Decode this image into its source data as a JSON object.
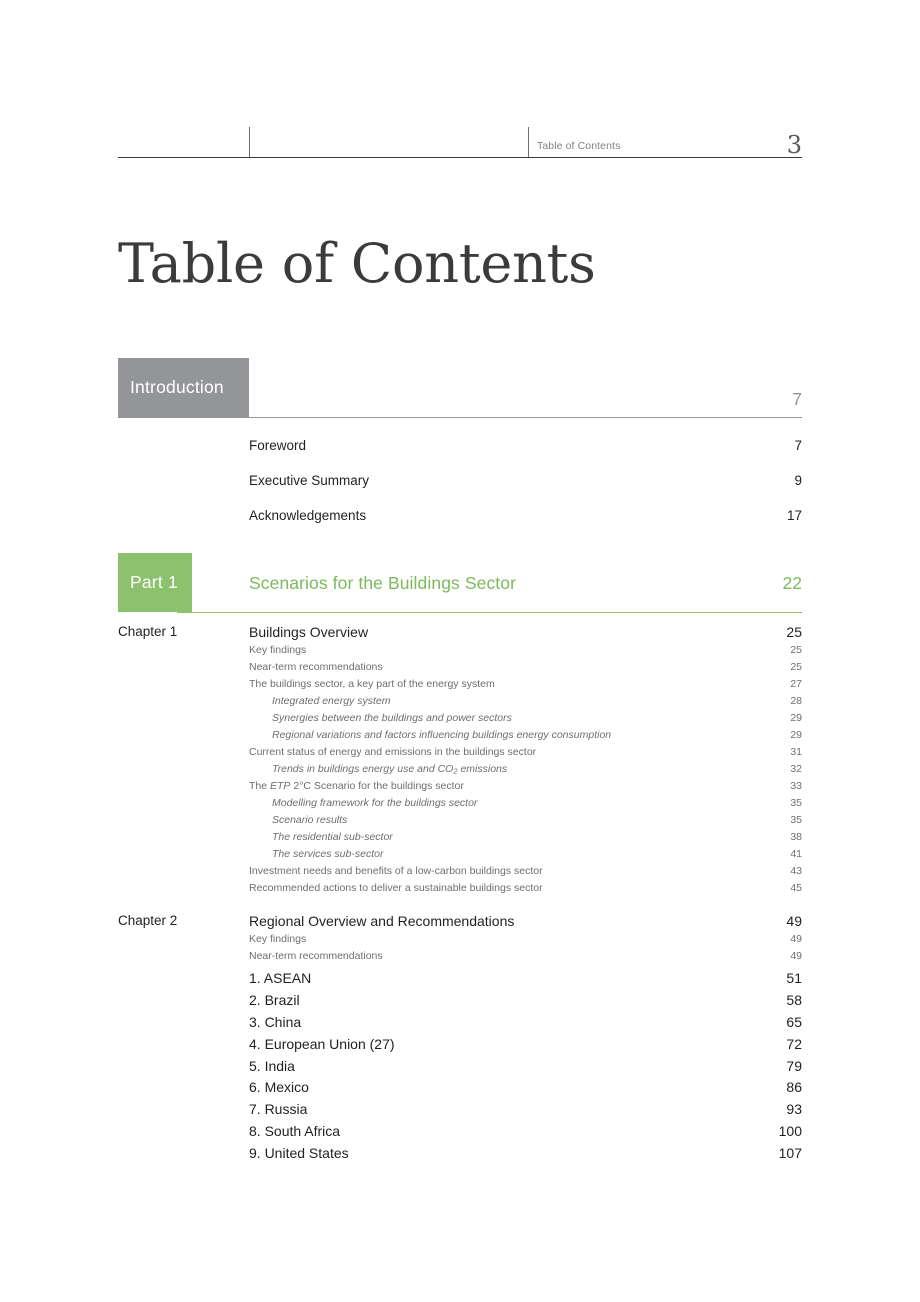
{
  "header": {
    "label": "Table of Contents",
    "page_number": "3"
  },
  "title": "Table of Contents",
  "sections": [
    {
      "banner_label": "Introduction",
      "banner_title": "",
      "banner_page": "7",
      "accent_color": "#939598",
      "entries": [
        {
          "label": "",
          "text": "Foreword",
          "page": "7",
          "level": "intro"
        },
        {
          "label": "",
          "text": "Executive Summary",
          "page": "9",
          "level": "intro"
        },
        {
          "label": "",
          "text": "Acknowledgements",
          "page": "17",
          "level": "intro"
        }
      ]
    },
    {
      "banner_label": "Part 1",
      "banner_title": "Scenarios for the Buildings Sector",
      "banner_page": "22",
      "accent_color": "#7cb85c",
      "entries": [
        {
          "label": "Chapter 1",
          "text": "Buildings Overview",
          "page": "25",
          "level": "1"
        },
        {
          "label": "",
          "text": "Key findings",
          "page": "25",
          "level": "2"
        },
        {
          "label": "",
          "text": "Near-term recommendations",
          "page": "25",
          "level": "2"
        },
        {
          "label": "",
          "text": "The buildings sector, a key part of the energy system",
          "page": "27",
          "level": "2"
        },
        {
          "label": "",
          "text": "Integrated energy system",
          "page": "28",
          "level": "3"
        },
        {
          "label": "",
          "text": "Synergies between the buildings and power sectors",
          "page": "29",
          "level": "3"
        },
        {
          "label": "",
          "text": "Regional variations and factors influencing buildings energy consumption",
          "page": "29",
          "level": "3"
        },
        {
          "label": "",
          "text": "Current status of energy and emissions in the buildings sector",
          "page": "31",
          "level": "2"
        },
        {
          "label": "",
          "text": "Trends in buildings energy use and CO2 emissions",
          "page": "32",
          "level": "3",
          "html": "Trends in buildings energy use and CO<sub>2</sub> emissions"
        },
        {
          "label": "",
          "text": "The ETP 2°C Scenario for the buildings sector",
          "page": "33",
          "level": "2",
          "html": "The <span class=\"it\">ETP</span> 2°C Scenario for the buildings sector"
        },
        {
          "label": "",
          "text": "Modelling framework for the buildings sector",
          "page": "35",
          "level": "3"
        },
        {
          "label": "",
          "text": "Scenario results",
          "page": "35",
          "level": "3"
        },
        {
          "label": "",
          "text": "The residential sub-sector",
          "page": "38",
          "level": "3"
        },
        {
          "label": "",
          "text": "The services sub-sector",
          "page": "41",
          "level": "3"
        },
        {
          "label": "",
          "text": "Investment needs and benefits of a low-carbon buildings sector",
          "page": "43",
          "level": "2"
        },
        {
          "label": "",
          "text": "Recommended actions to deliver a sustainable buildings sector",
          "page": "45",
          "level": "2"
        },
        {
          "label": "Chapter 2",
          "text": "Regional Overview and Recommendations",
          "page": "49",
          "level": "1"
        },
        {
          "label": "",
          "text": "Key findings",
          "page": "49",
          "level": "2"
        },
        {
          "label": "",
          "text": "Near-term recommendations",
          "page": "49",
          "level": "2"
        },
        {
          "label": "",
          "text": "1. ASEAN",
          "page": "51",
          "level": "num"
        },
        {
          "label": "",
          "text": "2. Brazil",
          "page": "58",
          "level": "num"
        },
        {
          "label": "",
          "text": "3. China",
          "page": "65",
          "level": "num"
        },
        {
          "label": "",
          "text": "4. European Union (27)",
          "page": "72",
          "level": "num"
        },
        {
          "label": "",
          "text": "5. India",
          "page": "79",
          "level": "num"
        },
        {
          "label": "",
          "text": "6. Mexico",
          "page": "86",
          "level": "num"
        },
        {
          "label": "",
          "text": "7. Russia",
          "page": "93",
          "level": "num"
        },
        {
          "label": "",
          "text": "8. South Africa",
          "page": "100",
          "level": "num"
        },
        {
          "label": "",
          "text": "9. United States",
          "page": "107",
          "level": "num"
        }
      ]
    }
  ]
}
